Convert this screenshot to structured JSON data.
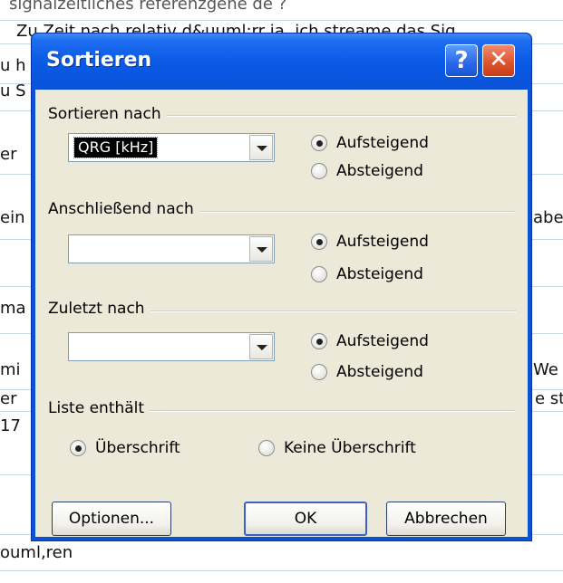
{
  "background": {
    "rows": [
      "signalzeitliches referenzgene de ?",
      "Zu Zeit nach relativ d&uuml;rr ja, ich streame das Sig",
      "u h",
      "u S",
      "er",
      "ein",
      "abe",
      "ma",
      "mi",
      "We",
      "er",
      "e st",
      "17",
      "ouml,ren"
    ]
  },
  "dialog": {
    "title": "Sortieren",
    "help_icon": "question-mark-icon",
    "close_icon": "close-x-icon",
    "sort_by": {
      "label": "Sortieren nach",
      "combo_value": "QRG [kHz]",
      "asc": "Aufsteigend",
      "desc": "Absteigend",
      "selected": "asc"
    },
    "then_by": {
      "label": "Anschließend nach",
      "combo_value": "",
      "asc": "Aufsteigend",
      "desc": "Absteigend",
      "selected": "asc"
    },
    "last_by": {
      "label": "Zuletzt nach",
      "combo_value": "",
      "asc": "Aufsteigend",
      "desc": "Absteigend",
      "selected": "asc"
    },
    "list_contains": {
      "label": "Liste enthält",
      "header": "Überschrift",
      "no_header": "Keine Überschrift",
      "selected": "header"
    },
    "buttons": {
      "options": "Optionen...",
      "ok": "OK",
      "cancel": "Abbrechen"
    }
  }
}
